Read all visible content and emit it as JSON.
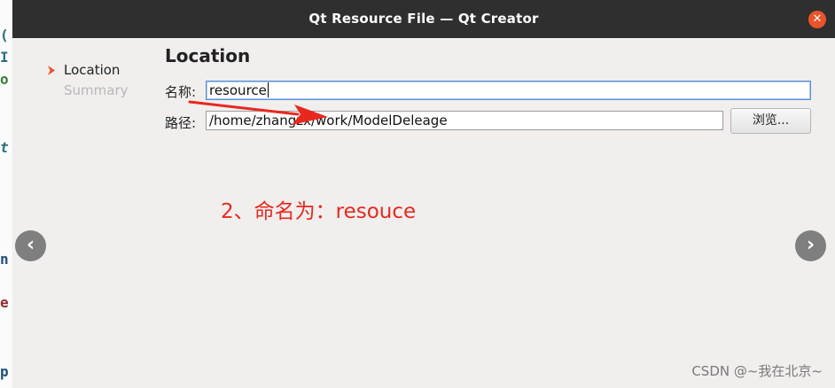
{
  "window": {
    "title": "Qt Resource File — Qt Creator",
    "close_icon": "close-icon"
  },
  "steps": [
    {
      "label": "Location",
      "active": true
    },
    {
      "label": "Summary",
      "active": false
    }
  ],
  "page": {
    "title": "Location",
    "name_label": "名称:",
    "name_value": "resource",
    "path_label": "路径:",
    "path_value": "/home/zhangzx/work/ModelDeleage",
    "browse_label": "浏览..."
  },
  "annotation": {
    "text": "2、命名为：resouce",
    "color": "#e8281f"
  },
  "overlay": {
    "prev_glyph": "‹",
    "next_glyph": "›",
    "watermark": "CSDN @~我在北京~"
  },
  "colors": {
    "accent": "#e9542a",
    "titlebar": "#2f2f2f"
  }
}
